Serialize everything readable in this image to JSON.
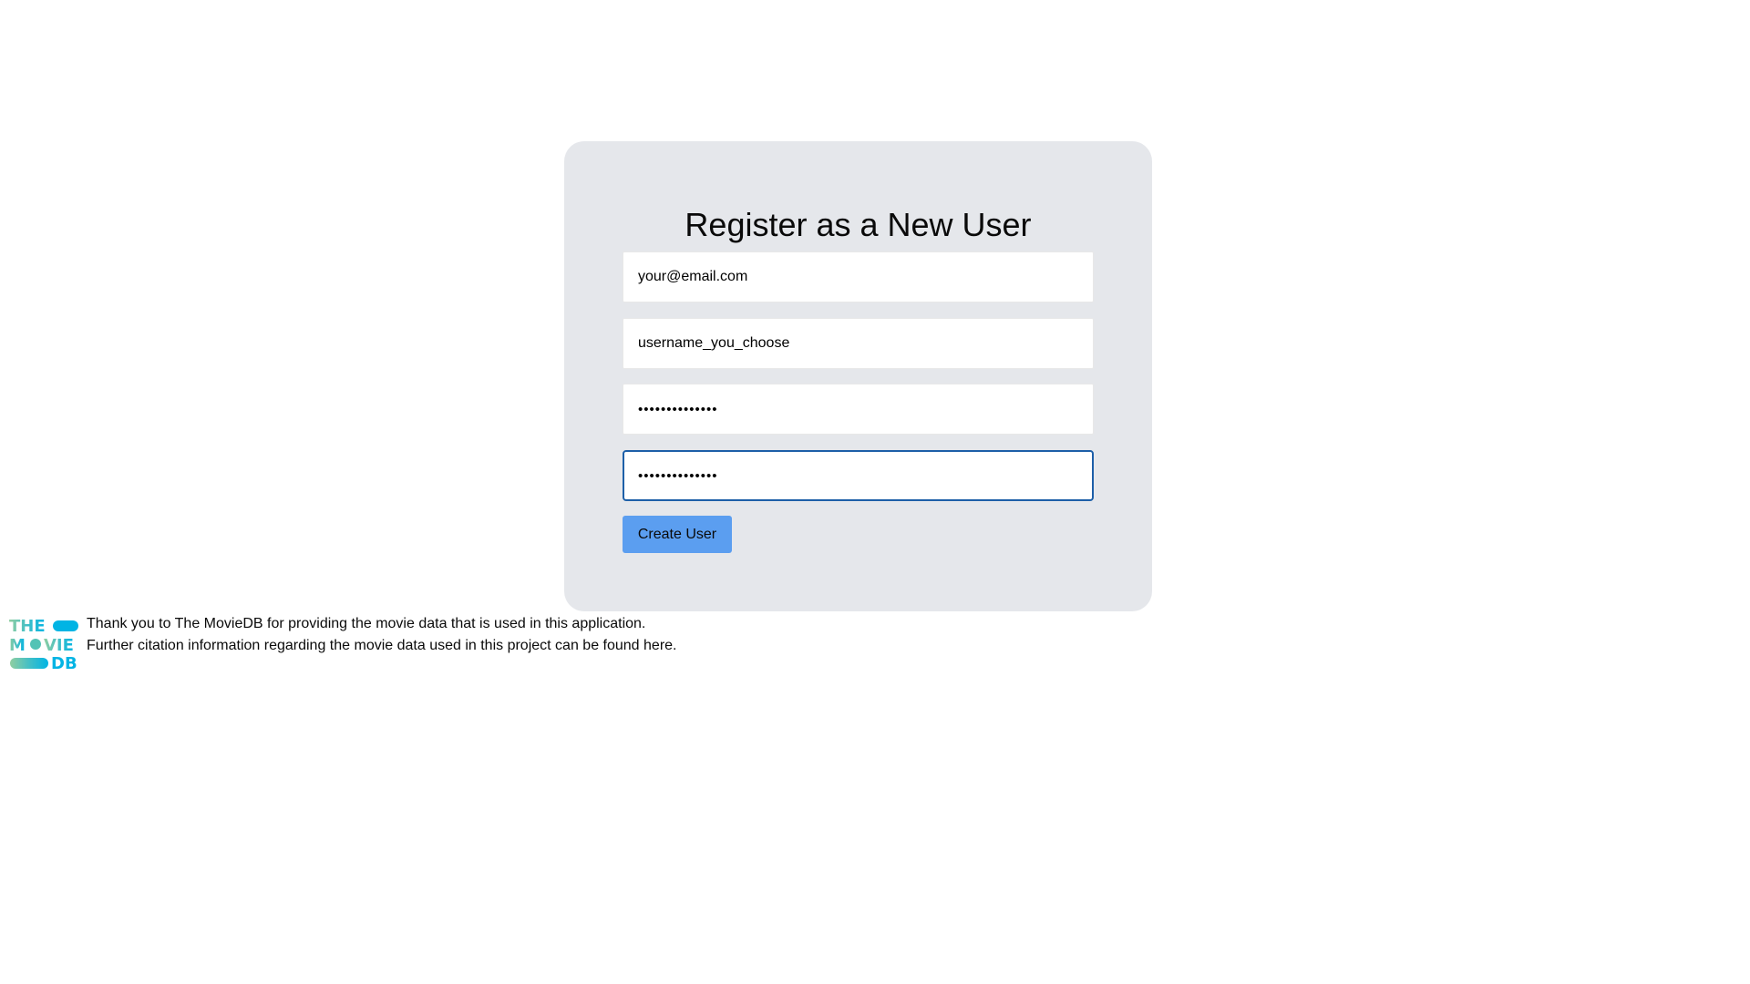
{
  "register": {
    "title": "Register as a New User",
    "email_value": "your@email.com",
    "username_value": "username_you_choose",
    "password_value": "••••••••••••••",
    "confirm_password_value": "••••••••••••••",
    "create_button_label": "Create User"
  },
  "footer": {
    "logo_text": {
      "line1": "THE",
      "line2_left": "M",
      "line2_right": "VIE",
      "line3": "DB"
    },
    "thanks_text": "Thank you to The MovieDB for providing the movie data that is used in this application.",
    "citation_text": "Further citation information regarding the movie data used in this project can be found here."
  },
  "colors": {
    "card_background": "#e5e7eb",
    "button_background": "#5b9ef0",
    "focus_border": "#1d5fa8",
    "tmdb_green": "#90cea1",
    "tmdb_blue": "#01b4e4"
  },
  "icons": {
    "logo": "tmdb-logo"
  }
}
